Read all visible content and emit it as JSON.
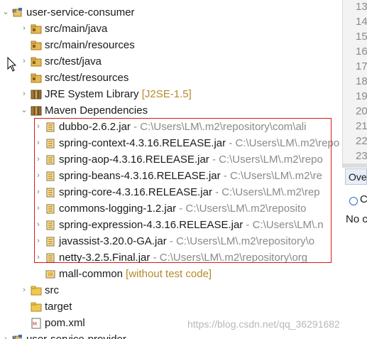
{
  "tree": {
    "root": {
      "label": "user-service-consumer"
    },
    "items": [
      {
        "label": "src/main/java",
        "type": "src-folder"
      },
      {
        "label": "src/main/resources",
        "type": "src-folder"
      },
      {
        "label": "src/test/java",
        "type": "src-folder"
      },
      {
        "label": "src/test/resources",
        "type": "src-folder"
      },
      {
        "label": "JRE System Library",
        "decoration": "[J2SE-1.5]",
        "type": "library"
      },
      {
        "label": "Maven Dependencies",
        "type": "library"
      }
    ],
    "dependencies": [
      {
        "name": "dubbo-2.6.2.jar",
        "path": "- C:\\Users\\LM\\.m2\\repository\\com\\ali"
      },
      {
        "name": "spring-context-4.3.16.RELEASE.jar",
        "path": "- C:\\Users\\LM\\.m2\\repo"
      },
      {
        "name": "spring-aop-4.3.16.RELEASE.jar",
        "path": "- C:\\Users\\LM\\.m2\\repo"
      },
      {
        "name": "spring-beans-4.3.16.RELEASE.jar",
        "path": "- C:\\Users\\LM\\.m2\\re"
      },
      {
        "name": "spring-core-4.3.16.RELEASE.jar",
        "path": "- C:\\Users\\LM\\.m2\\rep"
      },
      {
        "name": "commons-logging-1.2.jar",
        "path": "- C:\\Users\\LM\\.m2\\reposito"
      },
      {
        "name": "spring-expression-4.3.16.RELEASE.jar",
        "path": "- C:\\Users\\LM\\.n"
      },
      {
        "name": "javassist-3.20.0-GA.jar",
        "path": "- C:\\Users\\LM\\.m2\\repository\\o"
      },
      {
        "name": "netty-3.2.5.Final.jar",
        "path": "- C:\\Users\\LM\\.m2\\repository\\org"
      }
    ],
    "after": [
      {
        "label": "mall-common",
        "decoration": "[without test code]",
        "type": "project-ref"
      },
      {
        "label": "src",
        "type": "folder"
      },
      {
        "label": "target",
        "type": "folder"
      },
      {
        "label": "pom.xml",
        "type": "xml-file"
      },
      {
        "label": "user-service-provider",
        "type": "project"
      }
    ]
  },
  "editor": {
    "line_numbers": [
      "13",
      "14",
      "15",
      "16",
      "17",
      "18",
      "19",
      "20",
      "21",
      "22",
      "23"
    ]
  },
  "side_panel": {
    "tab_label": "Ove",
    "panel_heading": "C",
    "panel_text": "No c"
  },
  "watermark": "https://blog.csdn.net/qq_36291682",
  "colors": {
    "decoration": "#8a8a8a",
    "annotation": "#b58a2a",
    "highlight_box": "#d51a1a",
    "jar_icon": "#d9a441"
  }
}
